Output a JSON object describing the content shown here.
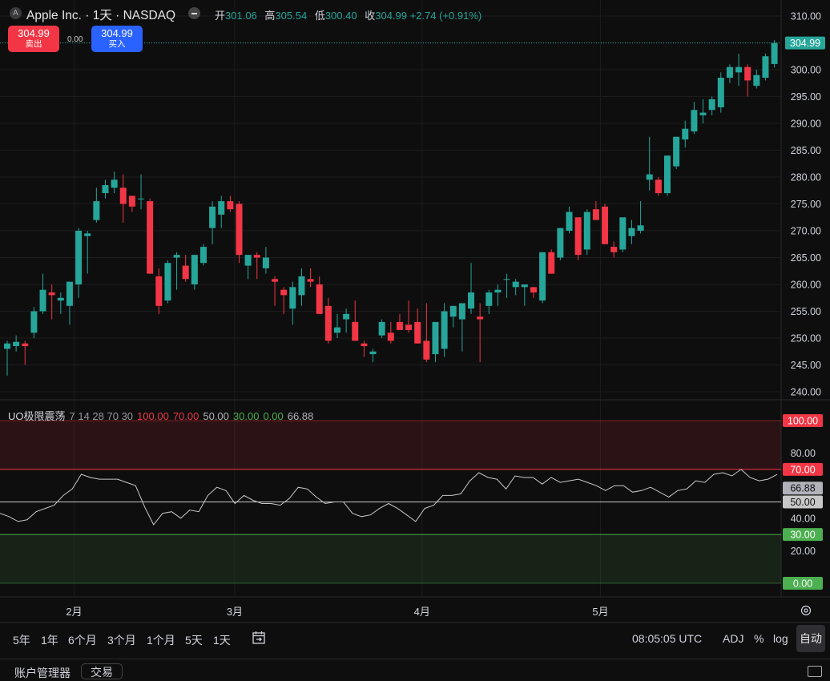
{
  "header": {
    "symbol_badge": "A",
    "symbol_title": "Apple Inc. · 1天 · NASDAQ",
    "ohlc": [
      {
        "k": "开",
        "v": "301.06"
      },
      {
        "k": "高",
        "v": "305.54"
      },
      {
        "k": "低",
        "v": "300.40"
      },
      {
        "k": "收",
        "v": "304.99 +2.74 (+0.91%)"
      }
    ]
  },
  "trade": {
    "sell_price": "304.99",
    "sell_label": "卖出",
    "spread": "0.00",
    "buy_price": "304.99",
    "buy_label": "买入"
  },
  "indicator_header": {
    "items": [
      {
        "text": "UO极限震荡",
        "color": "#d1d4dc"
      },
      {
        "text": "7 14 28 70 30",
        "color": "#9598a1"
      },
      {
        "text": "100.00",
        "color": "#f23645"
      },
      {
        "text": "70.00",
        "color": "#f23645"
      },
      {
        "text": "50.00",
        "color": "#b0b3ba"
      },
      {
        "text": "30.00",
        "color": "#4caf50"
      },
      {
        "text": "0.00",
        "color": "#4caf50"
      },
      {
        "text": "66.88",
        "color": "#b0b3ba"
      }
    ]
  },
  "toolbar": {
    "ranges": [
      "5年",
      "1年",
      "6个月",
      "3个月",
      "1个月",
      "5天",
      "1天"
    ],
    "time": "08:05:05 UTC",
    "adj": "ADJ",
    "percent": "%",
    "log": "log",
    "auto": "自动"
  },
  "bottom": {
    "account_manager": "账户管理器",
    "trade": "交易"
  },
  "colors": {
    "up": "#26a69a",
    "down": "#f23645",
    "background": "#0e0e0e",
    "uo_line": "#c8c8c8",
    "overbought": "#f23645",
    "oversold": "#4caf50"
  },
  "chart_data": [
    {
      "type": "candlestick",
      "title": "Apple Inc. · 1天 · NASDAQ",
      "ylim": [
        238,
        312
      ],
      "y_ticks": [
        "240.00",
        "245.00",
        "250.00",
        "255.00",
        "260.00",
        "265.00",
        "270.00",
        "275.00",
        "280.00",
        "285.00",
        "290.00",
        "295.00",
        "300.00",
        "305.00",
        "310.00"
      ],
      "x_labels": [
        {
          "label": "2月",
          "index": 7.5
        },
        {
          "label": "3月",
          "index": 25.5
        },
        {
          "label": "4月",
          "index": 46.5
        },
        {
          "label": "5月",
          "index": 66.5
        }
      ],
      "last_price": "304.99",
      "ohlc": [
        [
          248.0,
          249.5,
          243.0,
          249.0
        ],
        [
          248.5,
          250.5,
          247.5,
          249.3
        ],
        [
          249.0,
          249.5,
          245.0,
          248.5
        ],
        [
          251.0,
          255.8,
          250.0,
          255.0
        ],
        [
          255.0,
          262.0,
          254.5,
          259.0
        ],
        [
          258.5,
          260.0,
          253.5,
          258.0
        ],
        [
          257.0,
          258.5,
          254.5,
          257.5
        ],
        [
          256.0,
          260.0,
          252.5,
          260.5
        ],
        [
          260.0,
          270.5,
          257.5,
          270.0
        ],
        [
          269.0,
          270.0,
          262.0,
          269.5
        ],
        [
          272.0,
          278.0,
          271.5,
          275.5
        ],
        [
          277.0,
          279.5,
          276.0,
          278.5
        ],
        [
          278.0,
          281.0,
          277.0,
          279.5
        ],
        [
          278.0,
          280.5,
          271.5,
          275.0
        ],
        [
          276.5,
          276.5,
          273.5,
          274.5
        ],
        [
          276.0,
          280.5,
          274.0,
          276.0
        ],
        [
          275.5,
          276.0,
          262.0,
          262.0
        ],
        [
          261.5,
          263.0,
          254.5,
          256.0
        ],
        [
          257.0,
          264.5,
          256.5,
          264.0
        ],
        [
          265.0,
          266.0,
          259.0,
          265.5
        ],
        [
          263.5,
          265.5,
          260.5,
          261.0
        ],
        [
          260.0,
          265.5,
          259.0,
          265.5
        ],
        [
          264.0,
          267.5,
          263.5,
          267.0
        ],
        [
          270.5,
          275.5,
          267.5,
          274.5
        ],
        [
          273.0,
          276.5,
          270.5,
          275.5
        ],
        [
          275.5,
          276.5,
          273.5,
          274.0
        ],
        [
          275.0,
          275.5,
          264.0,
          265.5
        ],
        [
          263.5,
          265.5,
          261.0,
          265.5
        ],
        [
          265.5,
          266.0,
          261.0,
          265.0
        ],
        [
          263.0,
          267.0,
          262.0,
          265.0
        ],
        [
          261.0,
          261.5,
          256.0,
          260.5
        ],
        [
          259.0,
          259.5,
          254.5,
          258.0
        ],
        [
          255.5,
          260.5,
          252.5,
          259.5
        ],
        [
          258.0,
          263.0,
          256.0,
          261.5
        ],
        [
          261.0,
          263.0,
          259.5,
          260.5
        ],
        [
          260.0,
          261.5,
          254.5,
          254.5
        ],
        [
          256.0,
          257.5,
          249.0,
          249.5
        ],
        [
          251.0,
          254.5,
          250.0,
          252.0
        ],
        [
          253.5,
          255.5,
          251.0,
          254.5
        ],
        [
          253.0,
          257.0,
          249.5,
          249.5
        ],
        [
          249.0,
          249.5,
          246.5,
          248.5
        ],
        [
          247.0,
          248.0,
          245.5,
          247.5
        ],
        [
          250.5,
          253.5,
          250.0,
          253.0
        ],
        [
          251.0,
          253.0,
          249.0,
          249.5
        ],
        [
          253.0,
          254.5,
          251.5,
          251.5
        ],
        [
          252.5,
          257.0,
          251.0,
          251.5
        ],
        [
          253.0,
          255.5,
          249.0,
          249.0
        ],
        [
          249.5,
          256.5,
          245.5,
          246.0
        ],
        [
          247.0,
          252.5,
          245.5,
          253.0
        ],
        [
          248.0,
          256.5,
          246.5,
          255.0
        ],
        [
          254.0,
          256.0,
          252.0,
          256.0
        ],
        [
          253.5,
          256.0,
          247.5,
          256.5
        ],
        [
          255.5,
          264.0,
          254.5,
          258.5
        ],
        [
          254.0,
          256.5,
          245.5,
          253.5
        ],
        [
          256.0,
          259.0,
          254.5,
          258.5
        ],
        [
          258.5,
          260.0,
          256.0,
          259.0
        ],
        [
          261.0,
          262.0,
          257.5,
          261.0
        ],
        [
          259.5,
          261.0,
          258.0,
          260.5
        ],
        [
          259.5,
          260.0,
          256.0,
          260.0
        ],
        [
          259.5,
          259.5,
          257.5,
          258.5
        ],
        [
          257.0,
          262.5,
          256.5,
          266.0
        ],
        [
          266.0,
          266.5,
          262.0,
          262.0
        ],
        [
          265.0,
          270.5,
          264.5,
          270.5
        ],
        [
          270.0,
          274.5,
          269.5,
          273.5
        ],
        [
          272.5,
          272.5,
          264.5,
          265.5
        ],
        [
          266.5,
          274.0,
          265.5,
          273.5
        ],
        [
          274.0,
          275.5,
          272.0,
          272.0
        ],
        [
          274.5,
          275.0,
          271.5,
          267.5
        ],
        [
          267.0,
          268.0,
          265.0,
          266.0
        ],
        [
          266.5,
          272.0,
          266.0,
          272.5
        ],
        [
          269.0,
          272.0,
          267.5,
          270.5
        ],
        [
          270.0,
          275.5,
          269.5,
          271.0
        ],
        [
          279.5,
          287.5,
          277.5,
          280.5
        ],
        [
          279.5,
          280.0,
          276.5,
          277.0
        ],
        [
          277.0,
          284.0,
          276.5,
          284.0
        ],
        [
          282.0,
          287.5,
          281.5,
          287.5
        ],
        [
          287.0,
          290.5,
          285.5,
          289.0
        ],
        [
          288.5,
          294.0,
          288.0,
          292.5
        ],
        [
          291.5,
          294.5,
          290.0,
          292.0
        ],
        [
          292.5,
          295.0,
          291.5,
          294.5
        ],
        [
          293.0,
          299.5,
          292.0,
          298.5
        ],
        [
          298.5,
          301.0,
          297.5,
          300.5
        ],
        [
          299.5,
          303.0,
          297.0,
          300.5
        ],
        [
          300.5,
          301.0,
          295.0,
          298.0
        ],
        [
          297.0,
          300.0,
          296.5,
          299.0
        ],
        [
          298.5,
          303.0,
          298.0,
          302.5
        ],
        [
          301.06,
          305.54,
          300.4,
          304.99
        ]
      ]
    },
    {
      "type": "line",
      "title": "UO极限震荡 7 14 28 70 30",
      "ylim": [
        0,
        100
      ],
      "y_ticks": [
        "20.00",
        "40.00",
        "80.00"
      ],
      "levels": [
        {
          "label": "100.00",
          "value": 100,
          "color": "#f23645"
        },
        {
          "label": "70.00",
          "value": 70,
          "color": "#f23645"
        },
        {
          "label": "50.00",
          "value": 50,
          "color": "#b0b3ba"
        },
        {
          "label": "30.00",
          "value": 30,
          "color": "#4caf50"
        },
        {
          "label": "0.00",
          "value": 0,
          "color": "#4caf50"
        }
      ],
      "last_value": "66.88",
      "series": [
        {
          "values": [
            43,
            41,
            38,
            39,
            44,
            46,
            48,
            54,
            58,
            67,
            65,
            64,
            64,
            64,
            62,
            60,
            47,
            36,
            43,
            44,
            40,
            45,
            44,
            54,
            59,
            57,
            49,
            54,
            51,
            49,
            49,
            48,
            52,
            59,
            58,
            53,
            49,
            50,
            50,
            43,
            41,
            42,
            46,
            49,
            46,
            42,
            38,
            46,
            48,
            54,
            54,
            55,
            63,
            68,
            65,
            64,
            58,
            66,
            65,
            65,
            61,
            65,
            62,
            63,
            64,
            62,
            60,
            57,
            60,
            60,
            56,
            57,
            59,
            56,
            53,
            57,
            58,
            63,
            62,
            67,
            68,
            66,
            70,
            65,
            63,
            64,
            66.88
          ]
        }
      ]
    }
  ]
}
